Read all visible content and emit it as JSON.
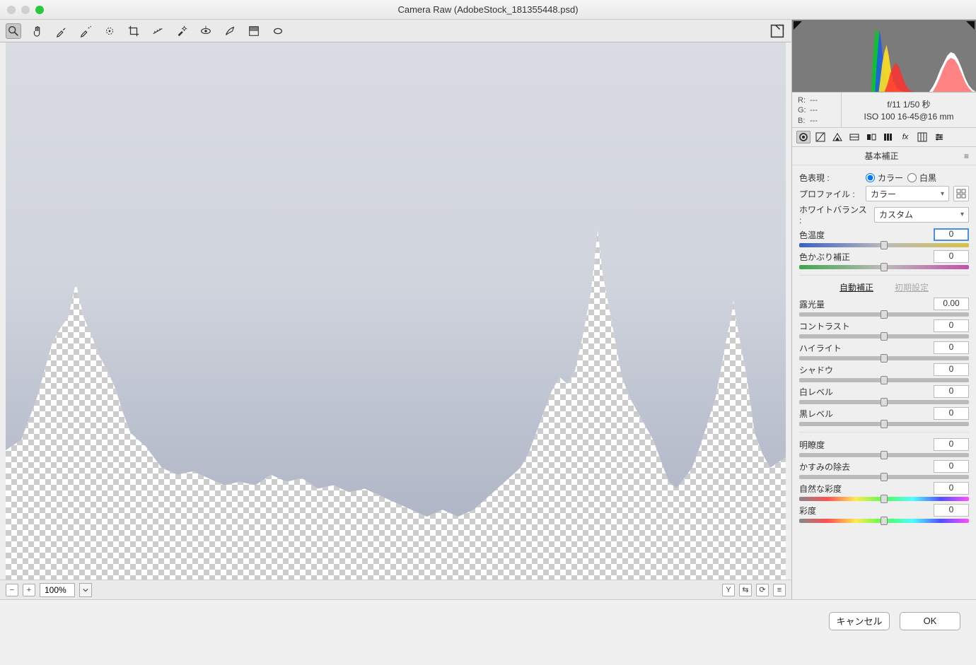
{
  "window": {
    "title": "Camera Raw (AdobeStock_181355448.psd)"
  },
  "toolbar": {
    "tools": [
      "zoom",
      "hand",
      "wb-picker",
      "color-sampler",
      "target-adjust",
      "crop",
      "straighten",
      "spot-removal",
      "red-eye",
      "adjustment-brush",
      "graduated-filter",
      "radial-filter"
    ],
    "fullscreen_name": "fullscreen-toggle"
  },
  "canvas_bar": {
    "zoom": "100%"
  },
  "right_footer": {
    "compare": "Y",
    "before_after": "⇆",
    "swap": "⟳",
    "prefs": "≡"
  },
  "histogram": {
    "clip_left": true,
    "clip_right": true
  },
  "exif": {
    "R": "---",
    "G": "---",
    "B": "---",
    "line1": "f/11   1/50 秒",
    "line2": "ISO 100   16-45@16 mm"
  },
  "panel_tabs": [
    "basic",
    "curve",
    "detail",
    "hsl",
    "split",
    "lens",
    "fx",
    "calib",
    "presets"
  ],
  "panel": {
    "title": "基本補正",
    "treatment_label": "色表現 :",
    "treatment_color": "カラー",
    "treatment_bw": "白黒",
    "profile_label": "プロファイル :",
    "profile_value": "カラー",
    "wb_label": "ホワイトバランス :",
    "wb_value": "カスタム",
    "sliders": {
      "temp": {
        "label": "色温度",
        "value": "0"
      },
      "tint": {
        "label": "色かぶり補正",
        "value": "0"
      },
      "exposure": {
        "label": "露光量",
        "value": "0.00"
      },
      "contrast": {
        "label": "コントラスト",
        "value": "0"
      },
      "highlights": {
        "label": "ハイライト",
        "value": "0"
      },
      "shadows": {
        "label": "シャドウ",
        "value": "0"
      },
      "whites": {
        "label": "白レベル",
        "value": "0"
      },
      "blacks": {
        "label": "黒レベル",
        "value": "0"
      },
      "clarity": {
        "label": "明瞭度",
        "value": "0"
      },
      "dehaze": {
        "label": "かすみの除去",
        "value": "0"
      },
      "vibrance": {
        "label": "自然な彩度",
        "value": "0"
      },
      "saturation": {
        "label": "彩度",
        "value": "0"
      }
    },
    "auto_label": "自動補正",
    "default_label": "初期設定"
  },
  "footer": {
    "cancel": "キャンセル",
    "ok": "OK"
  }
}
